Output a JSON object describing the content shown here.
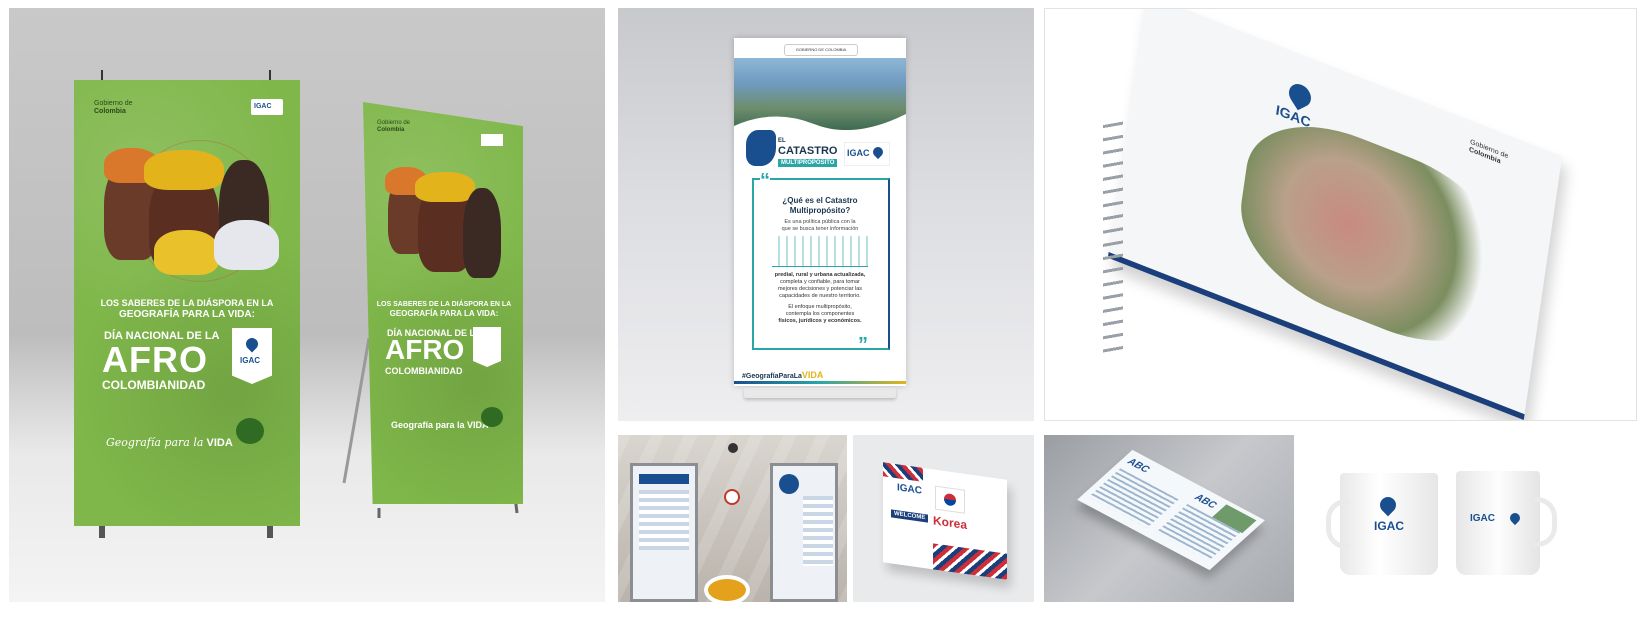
{
  "colors": {
    "banner_green": "#7fb74a",
    "igac_blue": "#1a4f8f",
    "teal": "#2aa6a6",
    "korea_red": "#cd2e3a"
  },
  "tile1": {
    "gov_logo_line1": "Gobierno de",
    "gov_logo_line2": "Colombia",
    "igac_logo": "IGAC",
    "headline_1": "LOS SABERES DE LA DIÁSPORA EN LA",
    "headline_2": "GEOGRAFÍA PARA LA VIDA:",
    "headline_3": "DÍA NACIONAL DE LA",
    "headline_4": "AFRO",
    "headline_5": "COLOMBIANIDAD",
    "signature_script": "Geografía para la",
    "signature_bold": "VIDA"
  },
  "tile2": {
    "top_tag": "GOBIERNO DE COLOMBIA",
    "el": "EL",
    "catastro": "CATASTRO",
    "multiproposito": "MULTIPROPÓSITO",
    "igac_logo": "IGAC",
    "question_1": "¿Qué es el Catastro",
    "question_2": "Multipropósito?",
    "desc_1": "Es una política pública con la",
    "desc_2": "que se busca tener información",
    "body_1": "predial, rural y urbana actualizada,",
    "body_2": "completa y confiable, para tomar",
    "body_3": "mejores decisiones y potenciar las",
    "body_4": "capacidades de nuestro territorio.",
    "body_5": "El enfoque multipropósito,",
    "body_6": "contempla los componentes",
    "body_7": "físicos, jurídicos y económicos.",
    "hashtag": "#GeografíaParaLa",
    "hashtag_bold": "VIDA"
  },
  "tile3": {
    "gov_line1": "Gobierno de",
    "gov_line2": "Colombia",
    "igac_logo": "IGAC"
  },
  "tile5": {
    "igac_logo": "IGAC",
    "welcome": "WELCOME",
    "korea": "Korea"
  },
  "tile6": {
    "abc_1": "ABC",
    "abc_2": "ABC"
  },
  "tile7": {
    "igac_logo": "IGAC"
  }
}
